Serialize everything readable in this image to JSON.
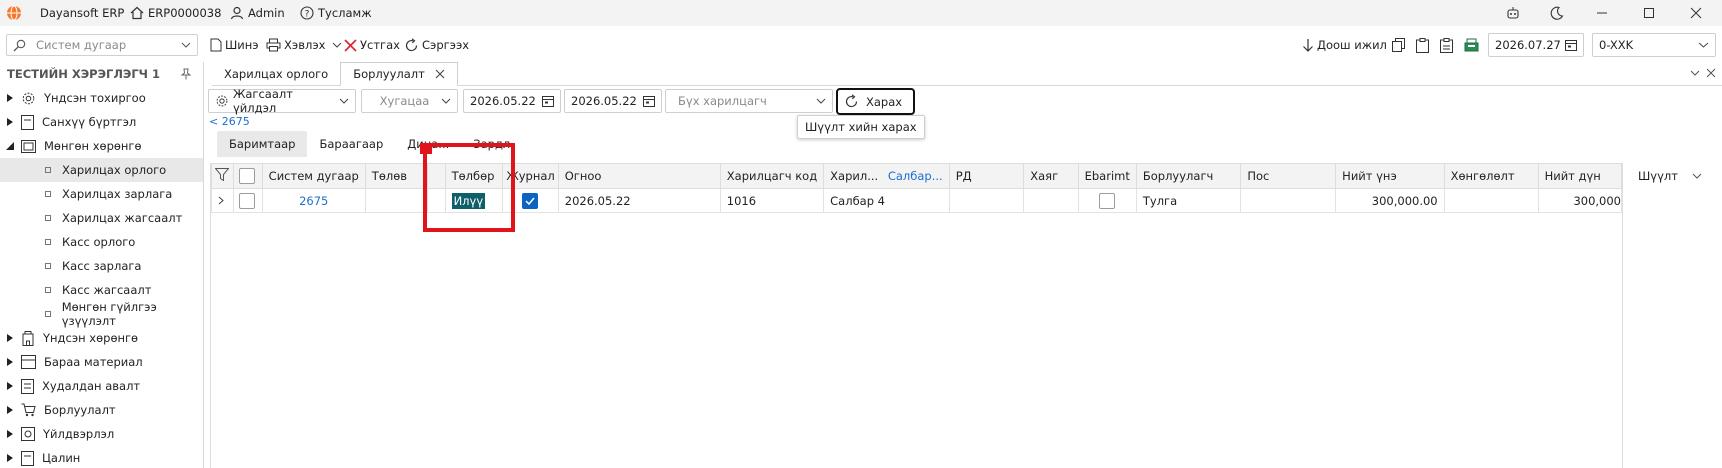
{
  "titlebar": {
    "app_name": "Dayansoft ERP",
    "company": "ERP0000038",
    "user": "Admin",
    "help": "Тусламж"
  },
  "toolbar": {
    "search_placeholder": "Систем дугаар",
    "new_label": "Шинэ",
    "print_label": "Хэвлэх",
    "delete_label": "Устгах",
    "refresh_label": "Сэргээх",
    "down_label": "Доош ижил",
    "date_value": "2026.07.27",
    "branch_value": "0-XXK"
  },
  "sidebar": {
    "title": "ТЕСТИЙН ХЭРЭГЛЭГЧ 1",
    "items": [
      {
        "label": "Үндсэн тохиргоо"
      },
      {
        "label": "Санхүү бүртгэл"
      },
      {
        "label": "Мөнгөн хөрөнгө"
      },
      {
        "label": "Харилцах орлого"
      },
      {
        "label": "Харилцах зарлага"
      },
      {
        "label": "Харилцах жагсаалт"
      },
      {
        "label": "Касс орлого"
      },
      {
        "label": "Касс зарлага"
      },
      {
        "label": "Касс жагсаалт"
      },
      {
        "label": "Мөнгөн гүйлгээ үзүүлэлт"
      },
      {
        "label": "Үндсэн хөрөнгө"
      },
      {
        "label": "Бараа материал"
      },
      {
        "label": "Худалдан авалт"
      },
      {
        "label": "Борлуулалт"
      },
      {
        "label": "Үйлдвэрлэл"
      },
      {
        "label": "Цалин"
      }
    ]
  },
  "tabs": [
    {
      "label": "Харилцах орлого"
    },
    {
      "label": "Борлуулалт"
    }
  ],
  "filters": {
    "list_action": "Жагсаалт үйлдэл",
    "period_placeholder": "Хугацаа",
    "date_from": "2026.05.22",
    "date_to": "2026.05.22",
    "customer_placeholder": "Бүх харилцагч",
    "view_button": "Харах",
    "back_link": "< 2675",
    "tooltip": "Шүүлт хийн харах"
  },
  "subtabs": [
    {
      "label": "Баримтаар"
    },
    {
      "label": "Бараагаар"
    },
    {
      "label": "Дина..."
    },
    {
      "label": "Зардл"
    }
  ],
  "grid": {
    "columns": {
      "sys_num": "Систем дугаар",
      "status": "Төлөв",
      "payment": "Төлбөр",
      "journal": "Журнал",
      "date": "Огноо",
      "cust_code": "Харилцагч код",
      "cust_name": "Харил...",
      "branch": "Салбар...",
      "rd": "РД",
      "address": "Хаяг",
      "ebarimt": "Ebarimt",
      "seller": "Борлуулагч",
      "pos": "Пос",
      "total": "Нийт үнэ",
      "discount": "Хөнгөлөлт",
      "grand_total": "Нийт дүн"
    },
    "rows": [
      {
        "sys_num": "2675",
        "status": "",
        "payment": "Илүү",
        "date": "2026.05.22",
        "cust_code": "1016",
        "cust_name": "Салбар 4",
        "rd": "",
        "address": "",
        "seller": "Тулга",
        "pos": "",
        "total": "300,000.00",
        "discount": "",
        "grand_total": "300,000"
      }
    ]
  },
  "right_panel": {
    "filter_label": "Шүүлт"
  }
}
